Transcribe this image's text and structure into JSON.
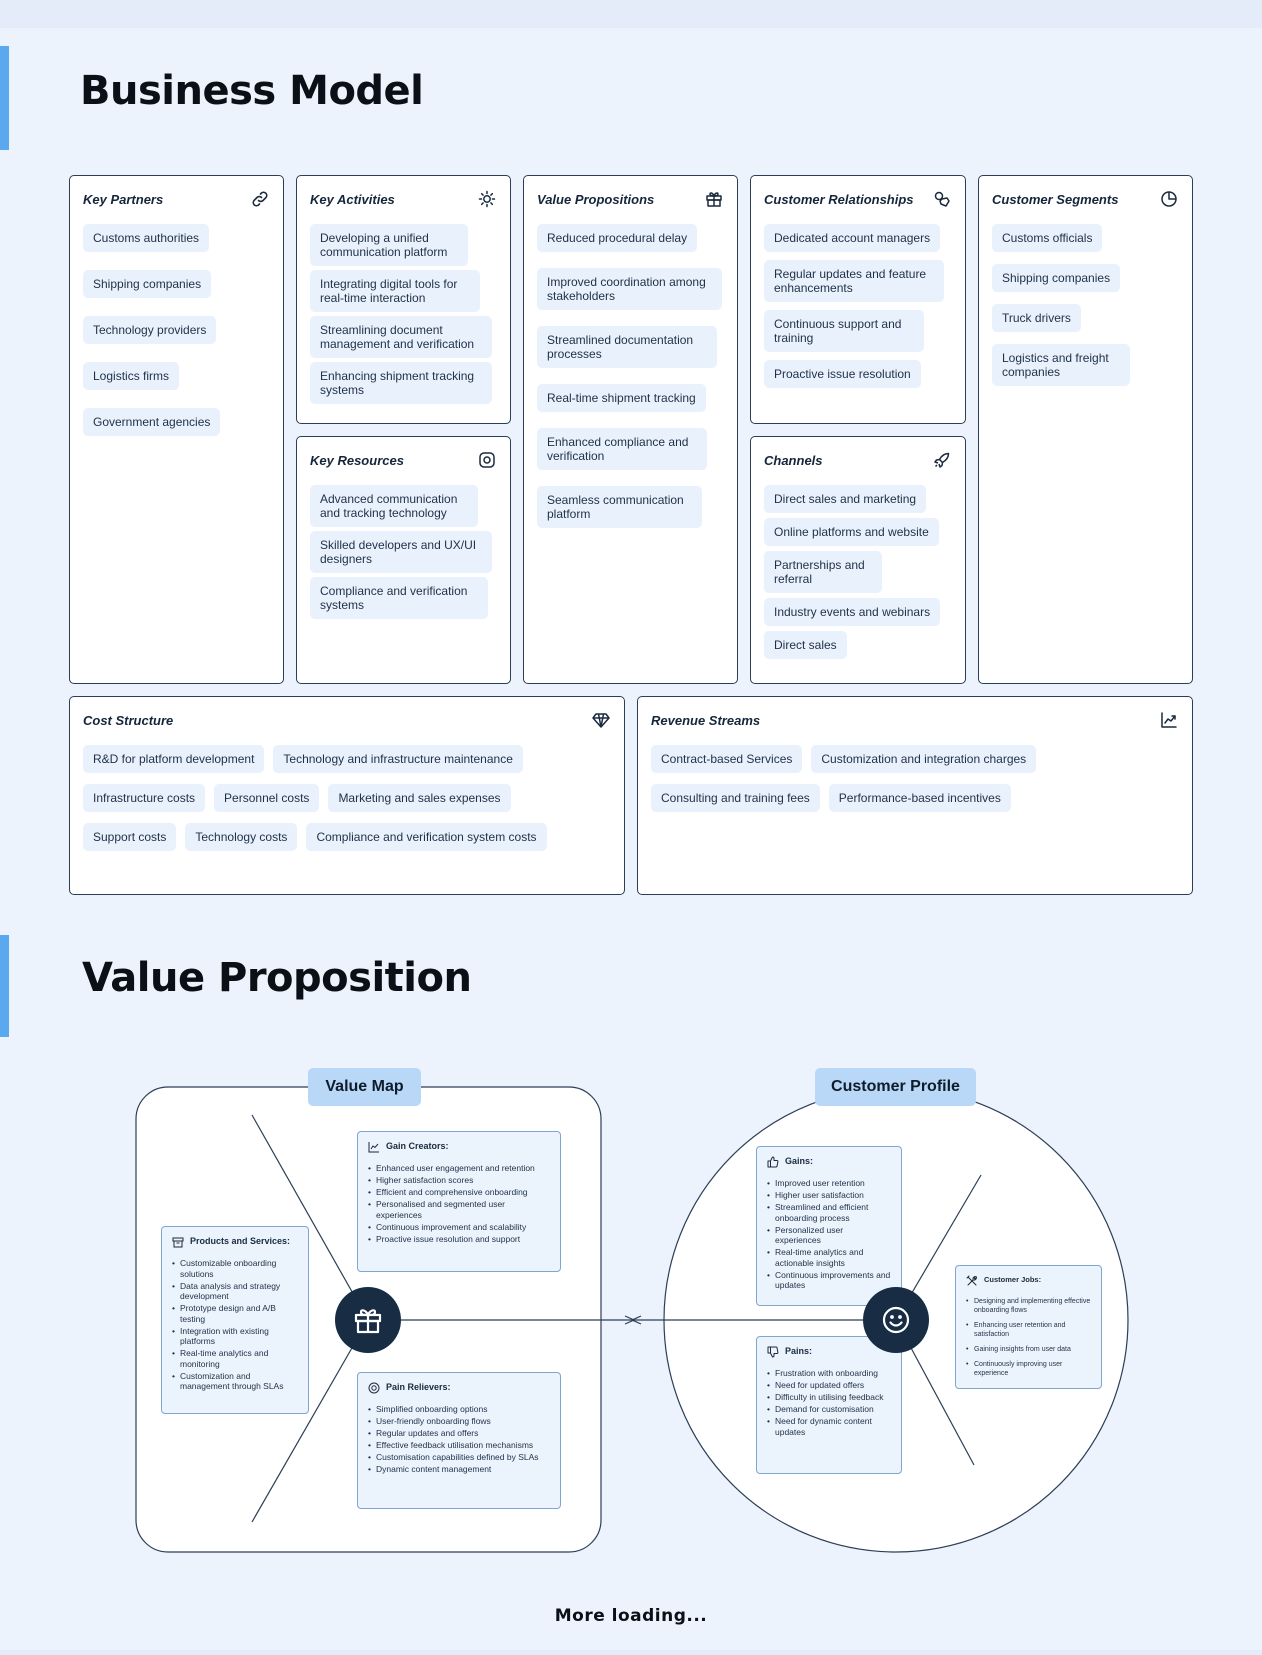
{
  "business_model": {
    "title": "Business Model",
    "key_partners": {
      "title": "Key Partners",
      "items": [
        "Customs authorities",
        "Shipping companies",
        "Technology providers",
        "Logistics firms",
        "Government agencies"
      ]
    },
    "key_activities": {
      "title": "Key Activities",
      "items": [
        "Developing a unified communication platform",
        "Integrating digital tools for real-time interaction",
        "Streamlining document management and verification",
        "Enhancing shipment tracking systems"
      ]
    },
    "key_resources": {
      "title": "Key Resources",
      "items": [
        "Advanced communication and tracking technology",
        "Skilled developers and UX/UI designers",
        "Compliance and verification systems"
      ]
    },
    "value_propositions": {
      "title": "Value Propositions",
      "items": [
        "Reduced procedural delay",
        "Improved coordination among stakeholders",
        "Streamlined documentation processes",
        "Real-time shipment tracking",
        "Enhanced compliance and verification",
        "Seamless communication platform"
      ]
    },
    "customer_relationships": {
      "title": "Customer Relationships",
      "items": [
        "Dedicated account managers",
        "Regular updates and feature enhancements",
        "Continuous support and training",
        "Proactive issue resolution"
      ]
    },
    "channels": {
      "title": "Channels",
      "items": [
        "Direct sales and marketing",
        "Online platforms and website",
        "Partnerships and referral",
        "Industry events and webinars",
        "Direct sales"
      ]
    },
    "customer_segments": {
      "title": "Customer Segments",
      "items": [
        "Customs officials",
        "Shipping companies",
        "Truck drivers",
        "Logistics and freight companies"
      ]
    },
    "cost_structure": {
      "title": "Cost Structure",
      "items": [
        "R&D for platform development",
        "Technology and infrastructure maintenance",
        "Infrastructure costs",
        "Personnel costs",
        "Marketing and sales expenses",
        "Support costs",
        "Technology costs",
        "Compliance and verification system costs"
      ]
    },
    "revenue_streams": {
      "title": "Revenue Streams",
      "items": [
        "Contract-based Services",
        "Customization and integration charges",
        "Consulting and training fees",
        "Performance-based incentives"
      ]
    }
  },
  "value_proposition": {
    "title": "Value Proposition",
    "value_map": {
      "label": "Value Map",
      "gain_creators": {
        "title": "Gain Creators:",
        "items": [
          "Enhanced user engagement and retention",
          "Higher satisfaction scores",
          "Efficient and comprehensive onboarding",
          "Personalised and segmented user experiences",
          "Continuous improvement and scalability",
          "Proactive issue resolution and support"
        ]
      },
      "products_services": {
        "title": "Products and Services:",
        "items": [
          "Customizable onboarding solutions",
          "Data analysis and strategy development",
          "Prototype design and A/B testing",
          "Integration with existing platforms",
          "Real-time analytics and monitoring",
          "Customization and management through SLAs"
        ]
      },
      "pain_relievers": {
        "title": "Pain Relievers:",
        "items": [
          "Simplified onboarding options",
          "User-friendly onboarding flows",
          "Regular updates and offers",
          "Effective feedback utilisation mechanisms",
          "Customisation capabilities defined by SLAs",
          "Dynamic content management"
        ]
      }
    },
    "customer_profile": {
      "label": "Customer Profile",
      "gains": {
        "title": "Gains:",
        "items": [
          "Improved user retention",
          "Higher user satisfaction",
          "Streamlined and efficient onboarding process",
          "Personalized user experiences",
          "Real-time analytics and actionable insights",
          "Continuous improvements and updates"
        ]
      },
      "pains": {
        "title": "Pains:",
        "items": [
          "Frustration with onboarding",
          "Need for updated offers",
          "Difficulty in utilising feedback",
          "Demand for customisation",
          "Need for dynamic content updates"
        ]
      },
      "customer_jobs": {
        "title": "Customer Jobs:",
        "items": [
          "Designing and implementing effective onboarding flows",
          "Enhancing user retention and satisfaction",
          "Gaining insights from user data",
          "Continuously improving user experience"
        ]
      }
    }
  },
  "footer": {
    "loading": "More loading..."
  },
  "colors": {
    "background": "#edf3fc",
    "accent": "#5aa8ee",
    "chip": "#e9f1fc",
    "label": "#b9d8f7",
    "hub": "#182c44",
    "border": "#2c3e55"
  }
}
